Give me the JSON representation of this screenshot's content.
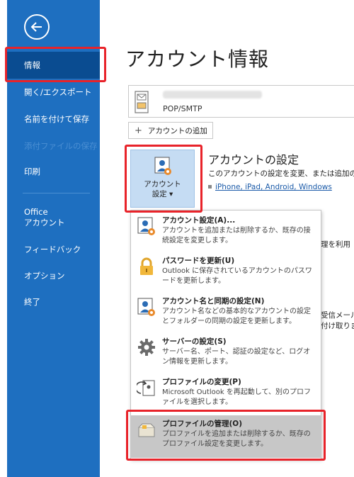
{
  "nav": {
    "items": [
      {
        "label": "情報"
      },
      {
        "label": "開く/エクスポート"
      },
      {
        "label": "名前を付けて保存"
      },
      {
        "label": "添付ファイルの保存"
      },
      {
        "label": "印刷"
      },
      {
        "label": "Office\nアカウント"
      },
      {
        "label": "フィードバック"
      },
      {
        "label": "オプション"
      },
      {
        "label": "終了"
      }
    ]
  },
  "main": {
    "title": "アカウント情報",
    "account": {
      "type": "POP/SMTP"
    },
    "add_account_label": "アカウントの追加",
    "settings_tile": {
      "label": "アカウント\n設定 ▾"
    },
    "settings_title": "アカウントの設定",
    "settings_desc": "このアカウントの設定を変更、または追加の接",
    "settings_link": "iPhone, iPad, Android, Windows",
    "bg_fragments": {
      "f1": "理を利用",
      "f2": "受信メール",
      "f3": "付け取ります。"
    }
  },
  "menu": {
    "items": [
      {
        "title": "アカウント設定(A)...",
        "desc": "アカウントを追加または削除するか、既存の接続設定を変更します。",
        "icon": "account-settings-icon"
      },
      {
        "title": "パスワードを更新(U)",
        "desc": "Outlook に保存されているアカウントのパスワードを更新します。",
        "icon": "lock-icon"
      },
      {
        "title": "アカウント名と同期の設定(N)",
        "desc": "アカウント名などの基本的なアカウントの設定とフォルダーの同期の設定を更新します。",
        "icon": "account-sync-icon"
      },
      {
        "title": "サーバーの設定(S)",
        "desc": "サーバー名、ポート、認証の設定など、ログオン情報を更新します。",
        "icon": "gear-icon"
      },
      {
        "title": "プロファイルの変更(P)",
        "desc": "Microsoft Outlook を再起動して、別のプロファイルを選択します。",
        "icon": "profile-change-icon"
      },
      {
        "title": "プロファイルの管理(O)",
        "desc": "プロファイルを追加または削除するか、既存のプロファイル設定を変更します。",
        "icon": "profile-manage-icon"
      }
    ]
  },
  "colors": {
    "nav_bg": "#1e6fc0",
    "nav_selected": "#0a4c91",
    "annotation_red": "#e8232a",
    "link": "#1a5aa8"
  }
}
